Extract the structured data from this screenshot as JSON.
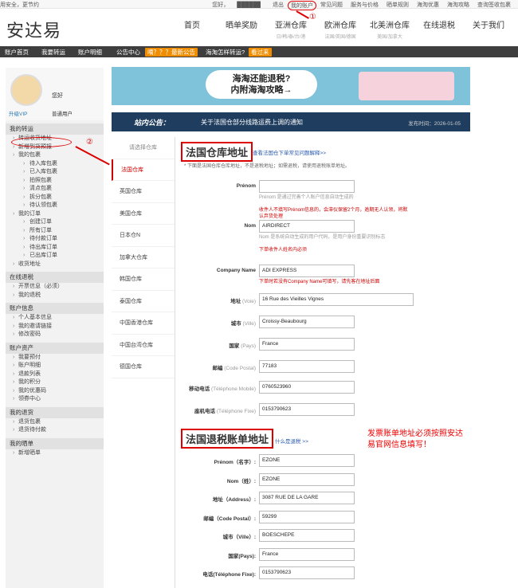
{
  "topbar": {
    "left": "用安全，更节约",
    "greeting": "您好，",
    "user": "██████",
    "links": [
      "退出",
      "我的账户",
      "常见问题",
      "服务与价格",
      "晒单规则",
      "海淘优惠",
      "海淘攻略",
      "查询签收包裹"
    ]
  },
  "logo": "安达易",
  "nav": [
    {
      "label": "首页",
      "sub": ""
    },
    {
      "label": "晒单奖励",
      "sub": ""
    },
    {
      "label": "亚洲仓库",
      "sub": "日/韩/泰/台/港"
    },
    {
      "label": "欧洲仓库",
      "sub": "法国/英国/德国"
    },
    {
      "label": "北美洲仓库",
      "sub": "美国/加拿大"
    },
    {
      "label": "在线退税",
      "sub": ""
    },
    {
      "label": "关于我们",
      "sub": ""
    }
  ],
  "subnav": {
    "items": [
      "账户首页",
      "我要转运",
      "账户明细",
      "公告中心",
      "海淘怎样转运?"
    ],
    "tag1": "嘀？？？最新公告",
    "tag2": "看过来"
  },
  "profile": {
    "hello": "您好",
    "upgrade": "升级VIP",
    "level": "普通用户"
  },
  "sidebar": {
    "sections": [
      {
        "title": "我的转运",
        "items": [
          {
            "t": "转运收货地址",
            "l": 1
          },
          {
            "t": "新增到货预报",
            "l": 1
          },
          {
            "t": "我的包裹",
            "l": 1
          },
          {
            "t": "待入库包裹",
            "l": 2
          },
          {
            "t": "已入库包裹",
            "l": 2
          },
          {
            "t": "拍照包裹",
            "l": 2
          },
          {
            "t": "清点包裹",
            "l": 2
          },
          {
            "t": "拆分包裹",
            "l": 2
          },
          {
            "t": "待认领包裹",
            "l": 2
          },
          {
            "t": "我的订单",
            "l": 1
          },
          {
            "t": "创建订单",
            "l": 2
          },
          {
            "t": "所有订单",
            "l": 2
          },
          {
            "t": "待付款订单",
            "l": 2
          },
          {
            "t": "待出库订单",
            "l": 2
          },
          {
            "t": "已出库订单",
            "l": 2
          },
          {
            "t": "收货地址",
            "l": 1
          }
        ]
      },
      {
        "title": "在线退税",
        "items": [
          {
            "t": "开票信息（必须）",
            "l": 1
          },
          {
            "t": "我的退税",
            "l": 1
          }
        ]
      },
      {
        "title": "账户信息",
        "items": [
          {
            "t": "个人基本信息",
            "l": 1
          },
          {
            "t": "我的邀请链接",
            "l": 1
          },
          {
            "t": "修改密码",
            "l": 1
          }
        ]
      },
      {
        "title": "账户资产",
        "items": [
          {
            "t": "我要预付",
            "l": 1
          },
          {
            "t": "账户明细",
            "l": 1
          },
          {
            "t": "退款列表",
            "l": 1
          },
          {
            "t": "我的积分",
            "l": 1
          },
          {
            "t": "我的优惠码",
            "l": 1
          },
          {
            "t": "领券中心",
            "l": 1
          }
        ]
      },
      {
        "title": "我的退货",
        "items": [
          {
            "t": "退货包裹",
            "l": 1
          },
          {
            "t": "退货待付款",
            "l": 1
          }
        ]
      },
      {
        "title": "我的晒单",
        "items": [
          {
            "t": "新增晒单",
            "l": 1
          }
        ]
      }
    ]
  },
  "banner": {
    "line1": "海淘还能退税?",
    "line2": "内附海淘攻略→"
  },
  "notice": {
    "label": "站内公告：",
    "message": "关于法国仓部分线路运费上调的通知",
    "date": "发布时间：2026-01-05"
  },
  "tabs": [
    "请选择仓库",
    "法国仓库",
    "英国仓库",
    "美国仓库",
    "日本仓N",
    "加拿大仓库",
    "韩国仓库",
    "泰国仓库",
    "中国香港仓库",
    "中国台湾仓库",
    "德国仓库"
  ],
  "warehouse": {
    "title": "法国仓库地址",
    "help": "查看法国仓下单常见问题解释>>",
    "notice": "* 下面是法国仓库仓库地址，不是退税地址；如需退税，请使用退税账单地址。",
    "fields": [
      {
        "label": "Prénom",
        "value": "",
        "hint": "Prénom 是通过完善个人账户信息自动生成的",
        "warn": "收件人不填写Prénom信息的，会滞仪保留2个月，逾期无人认领，将默认弃货处理"
      },
      {
        "label": "Nom",
        "value": "AIRDIRECT",
        "hint": "Nom 是系统自动生成的用户代码，是用户身份重要识别标志",
        "warn": "下单收件人姓名内必须"
      },
      {
        "label": "Company Name",
        "value": "ADI EXPRESS",
        "hint": "",
        "warn": "下单时若没有Company Name可填写，请先客在地址后面"
      },
      {
        "label": "地址",
        "sub": "(Voie)",
        "value": "16 Rue des Vieilles Vignes"
      },
      {
        "label": "城市",
        "sub": "(Ville)",
        "value": "Croissy-Beaubourg"
      },
      {
        "label": "国家",
        "sub": "(Pays)",
        "value": "France"
      },
      {
        "label": "邮编",
        "sub": "(Code Postal)",
        "value": "77183"
      },
      {
        "label": "移动电话",
        "sub": "(Téléphone Mobile)",
        "value": "0760523960"
      },
      {
        "label": "座机电话",
        "sub": "(Téléphone Fixe)",
        "value": "0153790623"
      }
    ]
  },
  "tax": {
    "title": "法国退税账单地址",
    "help": "什么是退税 >>",
    "note": "发票账单地址必须按照安达易官网信息填写！",
    "fields": [
      {
        "label": "Prénom（名字）:",
        "value": "EZONE"
      },
      {
        "label": "Nom（姓）:",
        "value": "EZONE"
      },
      {
        "label": "地址（Address）:",
        "value": "3087 RUE DE LA GARE"
      },
      {
        "label": "邮编（Code Postal）:",
        "value": "59299"
      },
      {
        "label": "城市（Ville）:",
        "value": "BOESCHEPE"
      },
      {
        "label": "国家(Pays):",
        "value": "France"
      },
      {
        "label": "电话(Téléphone Fixe):",
        "value": "0153790623"
      }
    ]
  },
  "markers": {
    "one": "①",
    "two": "②"
  },
  "colors": {
    "accent": "#d00000",
    "navbar": "#3e3e3e",
    "notice": "#1f3d5f"
  }
}
